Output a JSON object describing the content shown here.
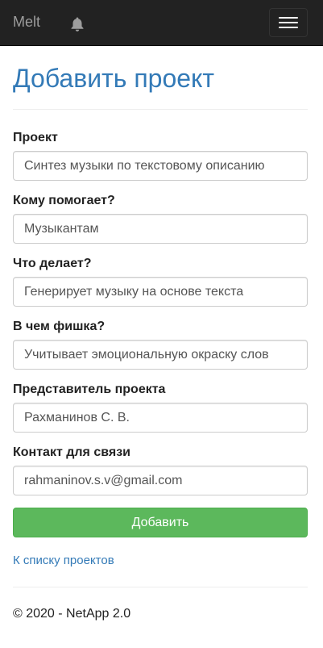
{
  "navbar": {
    "brand": "Melt",
    "bell_icon": "bell-icon",
    "menu_icon": "hamburger-menu-icon"
  },
  "page": {
    "title": "Добавить проект"
  },
  "form": {
    "fields": [
      {
        "label": "Проект",
        "value": "Синтез музыки по текстовому описанию"
      },
      {
        "label": "Кому помогает?",
        "value": "Музыкантам"
      },
      {
        "label": "Что делает?",
        "value": "Генерирует музыку на основе текста"
      },
      {
        "label": "В чем фишка?",
        "value": "Учитывает эмоциональную окраску слов"
      },
      {
        "label": "Представитель проекта",
        "value": "Рахманинов С. В."
      },
      {
        "label": "Контакт для связи",
        "value": "rahmaninov.s.v@gmail.com"
      }
    ],
    "submit_label": "Добавить"
  },
  "links": {
    "back": "К списку проектов"
  },
  "footer": {
    "text": "© 2020 - NetApp 2.0"
  },
  "colors": {
    "navbar_bg": "#222222",
    "title": "#337ab7",
    "submit_bg": "#5cb85c",
    "link": "#337ab7"
  }
}
